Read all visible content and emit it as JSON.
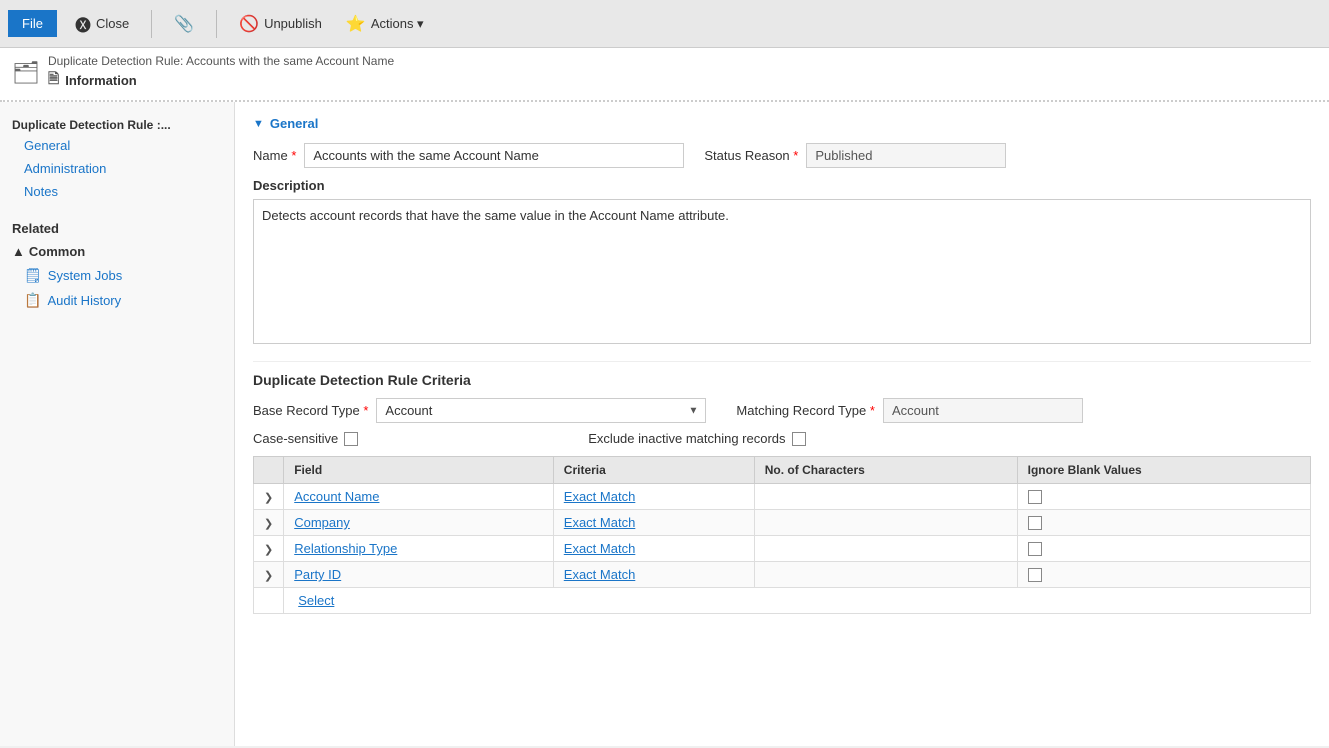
{
  "toolbar": {
    "file_label": "File",
    "close_label": "Close",
    "unpublish_label": "Unpublish",
    "actions_label": "Actions ▾",
    "attachment_icon": "📎"
  },
  "breadcrumb": {
    "text": "Duplicate Detection Rule: Accounts with the same Account Name",
    "page_title": "Information",
    "page_icon": "🗎"
  },
  "sidebar": {
    "section_title": "Duplicate Detection Rule :...",
    "items": [
      {
        "label": "General"
      },
      {
        "label": "Administration"
      },
      {
        "label": "Notes"
      }
    ],
    "related_title": "Related",
    "common_title": "Common",
    "common_items": [
      {
        "label": "System Jobs",
        "icon": "🗒"
      },
      {
        "label": "Audit History",
        "icon": "📋"
      }
    ]
  },
  "general": {
    "section_label": "General",
    "name_label": "Name",
    "name_value": "Accounts with the same Account Name",
    "status_reason_label": "Status Reason",
    "status_reason_value": "Published",
    "description_label": "Description",
    "description_value": "Detects account records that have the same value in the Account Name attribute."
  },
  "criteria": {
    "section_label": "Duplicate Detection Rule Criteria",
    "base_record_type_label": "Base Record Type",
    "base_record_type_value": "Account",
    "matching_record_type_label": "Matching Record Type",
    "matching_record_type_value": "Account",
    "case_sensitive_label": "Case-sensitive",
    "exclude_inactive_label": "Exclude inactive matching records",
    "table": {
      "headers": [
        "",
        "Field",
        "Criteria",
        "No. of Characters",
        "Ignore Blank Values"
      ],
      "rows": [
        {
          "field": "Account Name",
          "criteria": "Exact Match",
          "chars": "",
          "ignore": false
        },
        {
          "field": "Company",
          "criteria": "Exact Match",
          "chars": "",
          "ignore": false
        },
        {
          "field": "Relationship Type",
          "criteria": "Exact Match",
          "chars": "",
          "ignore": false
        },
        {
          "field": "Party ID",
          "criteria": "Exact Match",
          "chars": "",
          "ignore": false
        }
      ],
      "select_label": "Select"
    }
  }
}
